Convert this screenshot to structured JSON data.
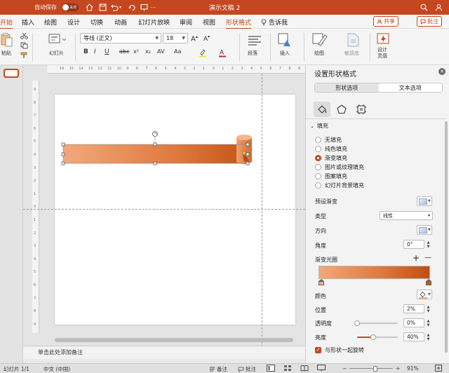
{
  "window": {
    "title": "演示文稿 2",
    "autosave_label": "自动保存",
    "autosave_state": "关闭"
  },
  "tabs": [
    {
      "label": "开始",
      "active": true
    },
    {
      "label": "插入"
    },
    {
      "label": "绘图"
    },
    {
      "label": "设计"
    },
    {
      "label": "切换"
    },
    {
      "label": "动画"
    },
    {
      "label": "幻灯片放映"
    },
    {
      "label": "审阅"
    },
    {
      "label": "视图"
    },
    {
      "label": "形状格式",
      "active": true
    },
    {
      "label": "告诉我"
    }
  ],
  "share_label": "共享",
  "comment_label": "批注",
  "ribbon": {
    "paste_label": "粘贴",
    "slides_label": "幻灯片",
    "font_name": "等线 (正文)",
    "font_size": "18",
    "format_bold": "B",
    "format_italic": "I",
    "format_underline": "U",
    "format_strike": "abc",
    "format_super": "x²",
    "format_sub": "x₂",
    "format_spacing": "AV",
    "format_case": "Aa",
    "paragraph_label": "段落",
    "insert_label": "插入",
    "drawing_label": "绘图",
    "sensitivity_label": "敏感度",
    "designer_label": "设计\n灵感"
  },
  "rulers": {
    "h_ticks": [
      "16",
      "15",
      "14",
      "13",
      "12",
      "11",
      "10",
      "9",
      "8",
      "7",
      "6",
      "5",
      "4",
      "3",
      "2",
      "1",
      "0",
      "1",
      "2",
      "3",
      "4",
      "5",
      "6",
      "7",
      "8",
      "9"
    ],
    "v_ticks": [
      "9",
      "8",
      "7",
      "6",
      "5",
      "4",
      "3",
      "2",
      "1",
      "0",
      "1",
      "2",
      "3",
      "4",
      "5",
      "6",
      "7",
      "8",
      "9"
    ]
  },
  "notes_placeholder": "单击此处添加备注",
  "statusbar": {
    "slide_info": "幻灯片 1/1",
    "language": "中文 (中国)",
    "notes_label": "备注",
    "comments_label": "批注",
    "zoom": "91%"
  },
  "panel": {
    "title": "设置形状格式",
    "seg_shape": "形状选项",
    "seg_text": "文本选项",
    "section_fill": "填充",
    "fill_options": [
      {
        "label": "无填充",
        "selected": false
      },
      {
        "label": "纯色填充",
        "selected": false
      },
      {
        "label": "渐变填充",
        "selected": true
      },
      {
        "label": "图片或纹理填充",
        "selected": false
      },
      {
        "label": "图案填充",
        "selected": false
      },
      {
        "label": "幻灯片背景填充",
        "selected": false
      }
    ],
    "preset_label": "预设渐变",
    "type_label": "类型",
    "type_value": "线性",
    "direction_label": "方向",
    "angle_label": "角度",
    "angle_value": "0°",
    "stops_label": "渐变光圈",
    "add_stop": "+",
    "remove_stop": "—",
    "color_label": "颜色",
    "position_label": "位置",
    "position_value": "2%",
    "transparency_label": "透明度",
    "transparency_value": "0%",
    "transparency_level": 0,
    "brightness_label": "亮度",
    "brightness_value": "40%",
    "brightness_level": 0.4,
    "rotate_label": "与形状一起旋转"
  },
  "colors": {
    "accent": "#c4471f",
    "shape_light": "#f2a97c",
    "shape_dark": "#c35515"
  }
}
